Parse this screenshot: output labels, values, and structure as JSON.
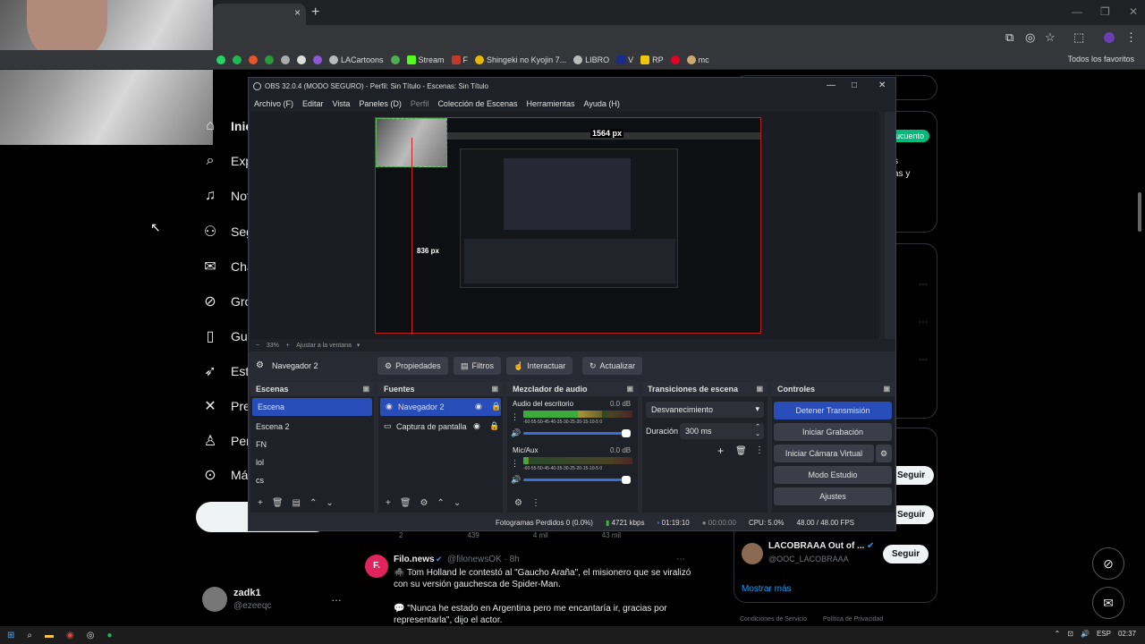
{
  "browser": {
    "tab_close": "×",
    "new_tab": "+",
    "bookmarks": [
      "LACartoons",
      "Stream",
      "F",
      "Shingeki no Kyojin 7...",
      "LIBRO",
      "V",
      "RP",
      "mc"
    ],
    "all_bookmarks": "Todos los favoritos"
  },
  "twitter": {
    "nav": [
      {
        "label": "Inic",
        "icon": "home-icon"
      },
      {
        "label": "Exp",
        "icon": "search-icon"
      },
      {
        "label": "Not",
        "icon": "bell-icon"
      },
      {
        "label": "Seg",
        "icon": "follow-icon"
      },
      {
        "label": "Cha",
        "icon": "mail-icon"
      },
      {
        "label": "Gro",
        "icon": "grok-icon"
      },
      {
        "label": "Gua",
        "icon": "bookmark-icon"
      },
      {
        "label": "Estu",
        "icon": "rocket-icon"
      },
      {
        "label": "Pre",
        "icon": "x-icon"
      },
      {
        "label": "Perf",
        "icon": "person-icon"
      },
      {
        "label": "Más",
        "icon": "more-icon"
      }
    ],
    "profile_name": "zadk1",
    "profile_handle": "@ezeeqc",
    "right": {
      "badge": "ucuento",
      "text_fragment1": "s",
      "text_fragment2": "as y",
      "follow_label": "Seguir",
      "suggest_name": "LACOBRAAA Out of ...",
      "suggest_handle": "@OOC_LACOBRAAA",
      "show_more": "Mostrar más",
      "footer_terms": "Condiciones de Servicio",
      "footer_privacy": "Política de Privacidad"
    },
    "tweet": {
      "stats": [
        "2",
        "439",
        "4 mil",
        "43 mil"
      ],
      "author": "Filo.news",
      "handle": "@filonewsOK · 8h",
      "line1": "🕷️ Tom Holland le contestó al \"Gaucho Araña\", el misionero que se viralizó con su versión gauchesca de Spider-Man.",
      "line2": "💬 \"Nunca he estado en Argentina pero me encantaría ir, gracias por representarla\", dijo el actor."
    }
  },
  "obs": {
    "title": "OBS 32.0.4 (MODO SEGURO) - Perfil: Sin Título - Escenas: Sin Título",
    "menu": [
      "Archivo (F)",
      "Editar",
      "Vista",
      "Paneles (D)",
      "Perfil",
      "Colección de Escenas",
      "Herramientas",
      "Ayuda (H)"
    ],
    "preview_width_label": "1564 px",
    "preview_height_label": "836 px",
    "zoom": "33%",
    "fit_label": "Ajustar a la ventana",
    "selected_source": "Navegador 2",
    "source_buttons": [
      "Propiedades",
      "Filtros",
      "Interactuar",
      "Actualizar"
    ],
    "docks": {
      "scenes_title": "Escenas",
      "scenes": [
        "Escena",
        "Escena 2",
        "FN",
        "lol",
        "cs"
      ],
      "sources_title": "Fuentes",
      "sources": [
        "Navegador 2",
        "Captura de pantalla"
      ],
      "mixer_title": "Mezclador de audio",
      "mixer": [
        {
          "name": "Audio del escritorio",
          "db": "0.0 dB",
          "level": 0.72
        },
        {
          "name": "Mic/Aux",
          "db": "0.0 dB",
          "level": 0.05
        }
      ],
      "meter_scale": "-60-55-50-45-40-35-30-25-20-15-10-5 0",
      "transitions_title": "Transiciones de escena",
      "transition": "Desvanecimiento",
      "duration_label": "Duración",
      "duration": "300 ms",
      "controls_title": "Controles",
      "controls": [
        "Detener Transmisión",
        "Iniciar Grabación",
        "Iniciar Cámara Virtual",
        "Modo Estudio",
        "Ajustes"
      ]
    },
    "status": {
      "dropped": "Fotogramas Perdidos 0 (0.0%)",
      "bitrate": "4721 kbps",
      "stream_time": "01:19:10",
      "rec_time": "00:00:00",
      "cpu": "CPU: 5.0%",
      "fps": "48.00 / 48.00 FPS"
    }
  },
  "taskbar": {
    "lang": "ESP",
    "time": "02:37"
  }
}
